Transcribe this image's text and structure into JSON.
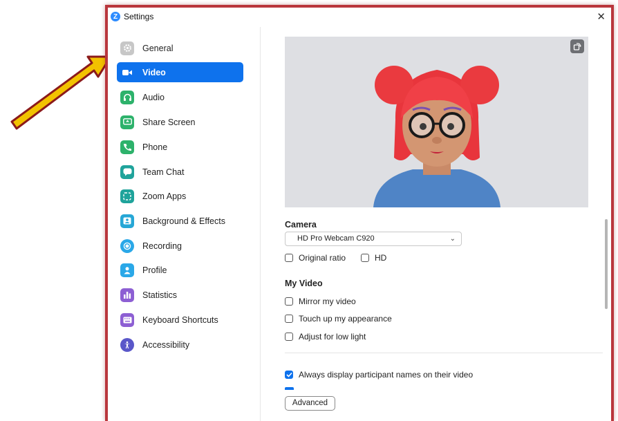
{
  "window": {
    "title": "Settings",
    "logo_letter": "Z",
    "close_label": "✕"
  },
  "sidebar": {
    "items": [
      {
        "label": "General",
        "icon": "gear-icon",
        "color": "#c7c7c7"
      },
      {
        "label": "Video",
        "icon": "video-camera-icon",
        "color": "#0e72ed",
        "active": true
      },
      {
        "label": "Audio",
        "icon": "headphones-icon",
        "color": "#2db26b"
      },
      {
        "label": "Share Screen",
        "icon": "share-screen-icon",
        "color": "#2db26b"
      },
      {
        "label": "Phone",
        "icon": "phone-icon",
        "color": "#2db26b"
      },
      {
        "label": "Team Chat",
        "icon": "chat-bubble-icon",
        "color": "#1fa39b"
      },
      {
        "label": "Zoom Apps",
        "icon": "apps-icon",
        "color": "#1fa39b"
      },
      {
        "label": "Background & Effects",
        "icon": "background-person-icon",
        "color": "#26a7d6"
      },
      {
        "label": "Recording",
        "icon": "recording-icon",
        "color": "#2aa8e8"
      },
      {
        "label": "Profile",
        "icon": "profile-icon",
        "color": "#2aa8e8"
      },
      {
        "label": "Statistics",
        "icon": "statistics-icon",
        "color": "#8d5fd3"
      },
      {
        "label": "Keyboard Shortcuts",
        "icon": "keyboard-icon",
        "color": "#8d5fd3"
      },
      {
        "label": "Accessibility",
        "icon": "accessibility-icon",
        "color": "#5a57c9"
      }
    ]
  },
  "video": {
    "camera_title": "Camera",
    "camera_selected": "HD Pro Webcam C920",
    "original_ratio_label": "Original ratio",
    "hd_label": "HD",
    "my_video_title": "My Video",
    "mirror_label": "Mirror my video",
    "touch_up_label": "Touch up my appearance",
    "low_light_label": "Adjust for low light",
    "display_names_label": "Always display participant names on their video",
    "advanced_label": "Advanced"
  },
  "colors": {
    "accent": "#0e72ed",
    "annotation_arrow": "#f2c200",
    "window_border": "#b9363c"
  }
}
